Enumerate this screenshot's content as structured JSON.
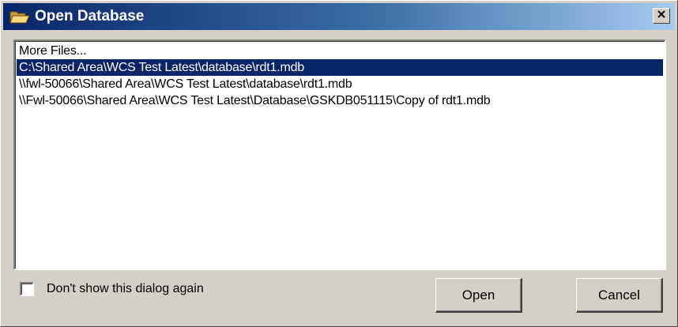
{
  "window": {
    "title": "Open Database",
    "icon": "folder-open-icon",
    "close_icon": "close-icon"
  },
  "file_list": {
    "items": [
      {
        "label": "More Files...",
        "selected": false
      },
      {
        "label": "C:\\Shared Area\\WCS Test Latest\\database\\rdt1.mdb",
        "selected": true
      },
      {
        "label": "\\\\fwl-50066\\Shared Area\\WCS Test Latest\\database\\rdt1.mdb",
        "selected": false
      },
      {
        "label": "\\\\Fwl-50066\\Shared Area\\WCS Test Latest\\Database\\GSKDB051115\\Copy of rdt1.mdb",
        "selected": false
      }
    ]
  },
  "options": {
    "dont_show_label": "Don't show this dialog again",
    "dont_show_checked": false
  },
  "buttons": {
    "open_label": "Open",
    "cancel_label": "Cancel"
  },
  "colors": {
    "title_gradient_start": "#0a246a",
    "title_gradient_end": "#a6caf0",
    "selection": "#0a246a",
    "dialog_bg": "#d4d0c8"
  }
}
